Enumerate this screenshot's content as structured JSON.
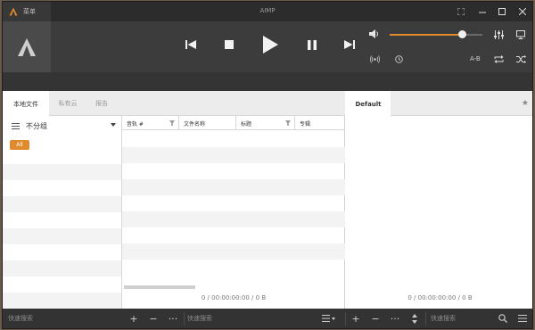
{
  "window": {
    "title": "AIMP",
    "menu_label": "菜单"
  },
  "colors": {
    "accent": "#e08a2c",
    "dark_bg": "#3c3c3c",
    "title_bg": "#2c2c2c"
  },
  "player": {
    "volume_fraction": 0.78,
    "ab_label": "A-B",
    "icons": [
      "prev-icon",
      "stop-icon",
      "play-icon",
      "pause-icon",
      "next-icon",
      "volume-icon",
      "equalizer-icon",
      "screen-icon",
      "radio-icon",
      "clock-icon",
      "repeat-icon",
      "shuffle-icon"
    ]
  },
  "library": {
    "tabs": [
      "本地文件",
      "私有云",
      "报告"
    ],
    "group_label": "不分组",
    "all_badge": "All",
    "columns": [
      "音轨 #",
      "文件名称",
      "标题",
      "专辑"
    ],
    "status": "0 / 00:00:00:00 / 0 B"
  },
  "playlist": {
    "tab": "Default",
    "status": "0 / 00:00:00:00 / 0 B"
  },
  "bottom": {
    "search1": "快速搜索",
    "search2": "快速搜索",
    "search3": "快速搜索"
  }
}
